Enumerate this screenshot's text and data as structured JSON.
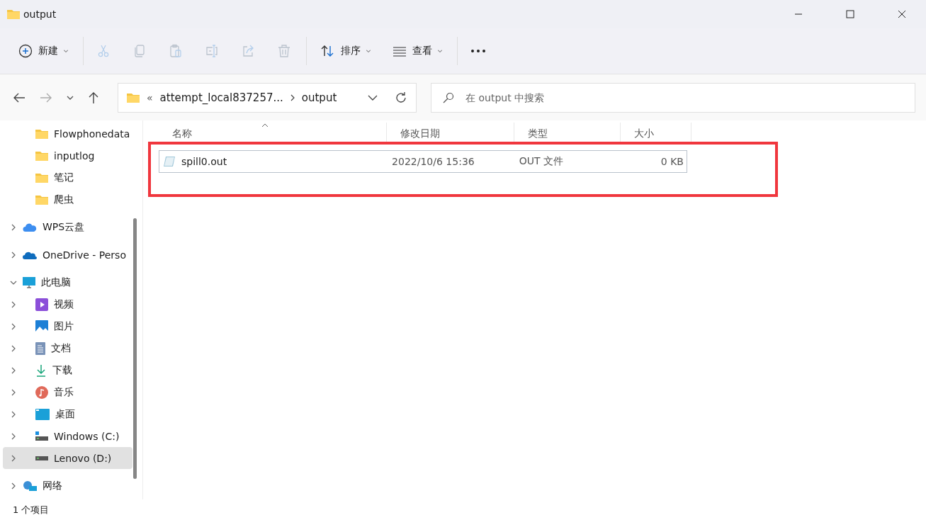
{
  "window": {
    "title": "output"
  },
  "toolbar": [
    {
      "kind": "new",
      "label": "新建",
      "disabled": false
    },
    {
      "kind": "cut",
      "disabled": true
    },
    {
      "kind": "copy",
      "disabled": true
    },
    {
      "kind": "paste",
      "disabled": true
    },
    {
      "kind": "rename",
      "disabled": true
    },
    {
      "kind": "share",
      "disabled": true
    },
    {
      "kind": "delete",
      "disabled": true
    },
    {
      "kind": "sort",
      "label": "排序",
      "disabled": false
    },
    {
      "kind": "view",
      "label": "查看",
      "disabled": false
    },
    {
      "kind": "more",
      "disabled": false
    }
  ],
  "address": {
    "overflow": "«",
    "segments": [
      "attempt_local837257...",
      "output"
    ]
  },
  "search": {
    "placeholder": "在 output 中搜索"
  },
  "quick_folders": [
    {
      "label": "Flowphonedata",
      "selected": false
    },
    {
      "label": "inputlog",
      "selected": false
    },
    {
      "label": "笔记",
      "selected": false
    },
    {
      "label": "爬虫",
      "selected": false
    }
  ],
  "sidebar": {
    "items": [
      {
        "kind": "cloud",
        "label": "WPS云盘",
        "expanded": false,
        "selected": false
      },
      {
        "kind": "onedrive",
        "label": "OneDrive - Perso",
        "expanded": false,
        "selected": false
      },
      {
        "kind": "pc",
        "label": "此电脑",
        "expanded": true,
        "selected": false,
        "children": [
          {
            "kind": "video",
            "label": "视频",
            "expanded": false,
            "selected": false
          },
          {
            "kind": "picture",
            "label": "图片",
            "expanded": false,
            "selected": false
          },
          {
            "kind": "doc",
            "label": "文档",
            "expanded": false,
            "selected": false
          },
          {
            "kind": "download",
            "label": "下载",
            "expanded": false,
            "selected": false
          },
          {
            "kind": "music",
            "label": "音乐",
            "expanded": false,
            "selected": false
          },
          {
            "kind": "desktop",
            "label": "桌面",
            "expanded": false,
            "selected": false
          },
          {
            "kind": "drive-c",
            "label": "Windows (C:)",
            "expanded": false,
            "selected": false
          },
          {
            "kind": "drive",
            "label": "Lenovo (D:)",
            "expanded": false,
            "selected": true
          }
        ]
      },
      {
        "kind": "network",
        "label": "网络",
        "expanded": false,
        "selected": false
      }
    ]
  },
  "table": {
    "columns": [
      {
        "label": "名称",
        "sorted": true
      },
      {
        "label": "修改日期",
        "sorted": false
      },
      {
        "label": "类型",
        "sorted": false
      },
      {
        "label": "大小",
        "sorted": false
      }
    ],
    "rows": [
      {
        "name": "spill0.out",
        "modified": "2022/10/6 15:36",
        "type": "OUT 文件",
        "size": "0 KB",
        "focused": true,
        "highlighted": true
      }
    ]
  },
  "status_bar": {
    "count": "1 个项目"
  }
}
